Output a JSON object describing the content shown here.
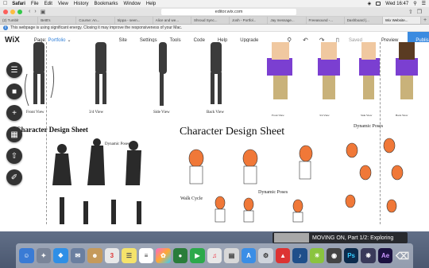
{
  "menubar": {
    "items": [
      "Safari",
      "File",
      "Edit",
      "View",
      "History",
      "Bookmarks",
      "Window",
      "Help"
    ],
    "clock": "Wed 16:47"
  },
  "browser": {
    "url": "editor.wix.com",
    "tabs": [
      "(2) Tumblr",
      "Bettt's",
      "Course: An...",
      "trippa - seen...",
      "Alice and we...",
      "Shroud Sync...",
      "Josh - Portfol...",
      "Jay message...",
      "Freeasound -...",
      "Dashboard |...",
      "Wix Website..."
    ],
    "notice": "This webpage is using significant energy. Closing it may improve the responsiveness of your Mac."
  },
  "wix": {
    "logo": "WiX",
    "page_label": "Page:",
    "page_value": "Portfolio",
    "nav": [
      "Site",
      "Settings",
      "Tools",
      "Code",
      "Help",
      "Upgrade"
    ],
    "saved": "Saved",
    "preview": "Preview",
    "publish": "Publish"
  },
  "canvas": {
    "top_labels": [
      "Front View",
      "3/4 View",
      "Side View",
      "Back View"
    ],
    "small_labels": [
      "Front View",
      "3/4 View",
      "Side View",
      "Back View"
    ],
    "left_title": "Character Design Sheet",
    "left_dynamic": "Dynamic Poses",
    "main_title": "Character Design Sheet",
    "dynamic_poses": "Dynamic Poses",
    "dynamic_poses_2": "Dynamic Poses",
    "walk_cycle": "Walk Cycle"
  },
  "notification": {
    "text": "MOVING ON, Part 1/2: Exploring"
  }
}
